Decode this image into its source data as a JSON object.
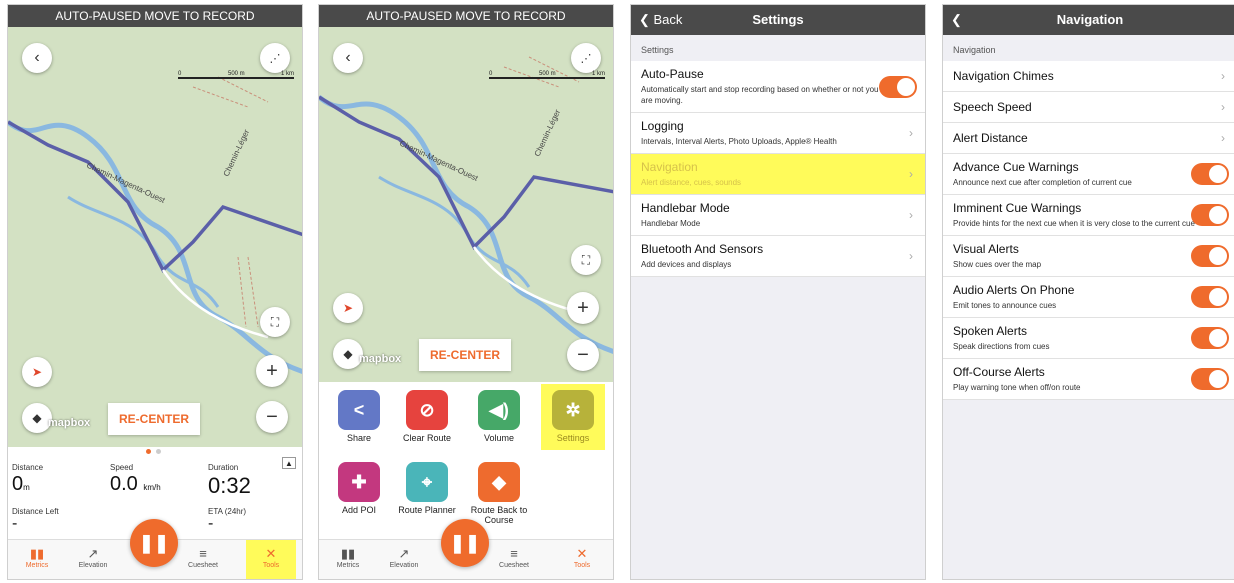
{
  "colors": {
    "accent": "#ef6b2c",
    "highlight": "#fffb5a",
    "bar": "#4a4a4a",
    "route": "#5b5fa8"
  },
  "screen1": {
    "banner": "AUTO-PAUSED MOVE TO RECORD",
    "scale": {
      "zero": "0",
      "mid": "500 m",
      "end": "1 km"
    },
    "road_labels": [
      "Chemin-Magenta-Ouest",
      "Chemin-Léger"
    ],
    "recenter": "RE-CENTER",
    "mapbox": "mapbox",
    "metrics": {
      "distance_label": "Distance",
      "distance_value": "0",
      "distance_unit": "m",
      "speed_label": "Speed",
      "speed_value": "0.0",
      "speed_unit": "km/h",
      "duration_label": "Duration",
      "duration_value": "0:32",
      "distance_left_label": "Distance Left",
      "distance_left_value": "-",
      "eta_label": "ETA (24hr)",
      "eta_value": "-"
    },
    "tabs": [
      "Metrics",
      "Elevation",
      "Cuesheet",
      "Tools"
    ]
  },
  "screen2": {
    "banner": "AUTO-PAUSED MOVE TO RECORD",
    "scale": {
      "zero": "0",
      "mid": "500 m",
      "end": "1 km"
    },
    "recenter": "RE-CENTER",
    "mapbox": "mapbox",
    "tools": [
      "Share",
      "Clear Route",
      "Volume",
      "Settings",
      "Add POI",
      "Route Planner",
      "Route Back to Course"
    ],
    "tabs": [
      "Metrics",
      "Elevation",
      "Cuesheet",
      "Tools"
    ]
  },
  "screen3": {
    "back": "Back",
    "title": "Settings",
    "section": "Settings",
    "rows": [
      {
        "title": "Auto-Pause",
        "subtitle": "Automatically start and stop recording based on whether or not you are moving.",
        "control": "toggle"
      },
      {
        "title": "Logging",
        "subtitle": "Intervals, Interval Alerts, Photo Uploads, Apple® Health",
        "control": "chevron"
      },
      {
        "title": "Navigation",
        "subtitle": "Alert distance, cues, sounds",
        "control": "chevron",
        "highlighted": true
      },
      {
        "title": "Handlebar Mode",
        "subtitle": "Handlebar Mode",
        "control": "chevron"
      },
      {
        "title": "Bluetooth And Sensors",
        "subtitle": "Add devices and displays",
        "control": "chevron"
      }
    ]
  },
  "screen4": {
    "title": "Navigation",
    "section": "Navigation",
    "rows": [
      {
        "title": "Navigation Chimes",
        "subtitle": "",
        "control": "chevron"
      },
      {
        "title": "Speech Speed",
        "subtitle": "",
        "control": "chevron"
      },
      {
        "title": "Alert Distance",
        "subtitle": "",
        "control": "chevron"
      },
      {
        "title": "Advance Cue Warnings",
        "subtitle": "Announce next cue after completion of current cue",
        "control": "toggle"
      },
      {
        "title": "Imminent Cue Warnings",
        "subtitle": "Provide hints for the next cue when it is very close to the current cue",
        "control": "toggle"
      },
      {
        "title": "Visual Alerts",
        "subtitle": "Show cues over the map",
        "control": "toggle"
      },
      {
        "title": "Audio Alerts On Phone",
        "subtitle": "Emit tones to announce cues",
        "control": "toggle"
      },
      {
        "title": "Spoken Alerts",
        "subtitle": "Speak directions from cues",
        "control": "toggle"
      },
      {
        "title": "Off-Course Alerts",
        "subtitle": "Play warning tone when off/on route",
        "control": "toggle"
      }
    ]
  }
}
